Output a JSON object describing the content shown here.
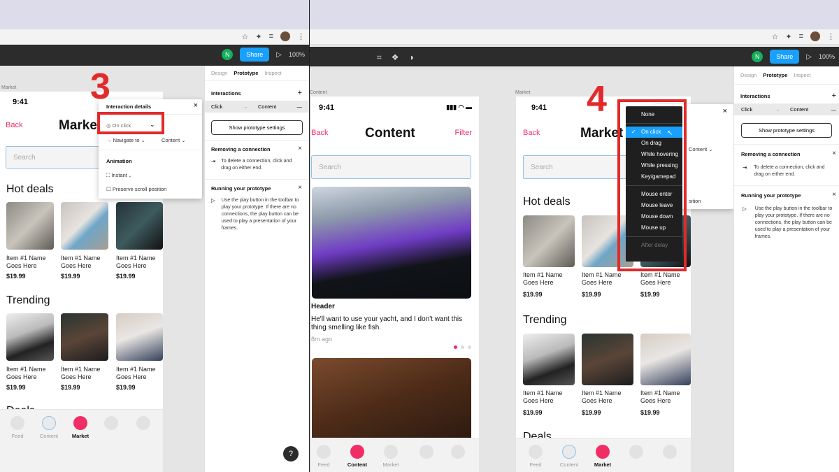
{
  "step_left": "3",
  "step_right": "4",
  "figma": {
    "avatar_letter": "N",
    "share": "Share",
    "play": "▷",
    "zoom": "100%"
  },
  "canvas_labels": {
    "market": "Market",
    "content": "Content"
  },
  "market": {
    "time": "9:41",
    "back": "Back",
    "title": "Market",
    "search_placeholder": "Search",
    "hot_deals": "Hot deals",
    "trending": "Trending",
    "deals": "Deals",
    "item_name": "Item #1 Name Goes Here",
    "price": "$19.99"
  },
  "content": {
    "time": "9:41",
    "back": "Back",
    "title": "Content",
    "filter": "Filter",
    "search_placeholder": "Search",
    "header": "Header",
    "body": "He'll want to use your yacht, and I don't want this thing smelling like fish.",
    "meta": "8m ago"
  },
  "tabs": [
    "Feed",
    "Content",
    "Market"
  ],
  "side": {
    "tabs": [
      "Design",
      "Prototype",
      "Inspect"
    ],
    "interactions": "Interactions",
    "trigger": "Click",
    "destination": "Content",
    "show_settings": "Show prototype settings",
    "removing_title": "Removing a connection",
    "removing_body": "To delete a connection, click and drag on either end.",
    "running_title": "Running your prototype",
    "running_body": "Use the play button in the toolbar to play your prototype. If there are no connections, the play button can be used to play a presentation of your frames."
  },
  "details": {
    "title": "Interaction details",
    "trigger": "On click",
    "action": "Navigate to",
    "destination": "Content",
    "animation": "Animation",
    "anim_value": "Instant",
    "preserve": "Preserve scroll position",
    "position_snip": "sition"
  },
  "dropdown": {
    "group1": [
      "None",
      "On click",
      "On drag",
      "While hovering",
      "While pressing",
      "Key/gamepad"
    ],
    "group2": [
      "Mouse enter",
      "Mouse leave",
      "Mouse down",
      "Mouse up"
    ],
    "group3": [
      "After delay"
    ],
    "selected": "On click"
  },
  "help": "?"
}
